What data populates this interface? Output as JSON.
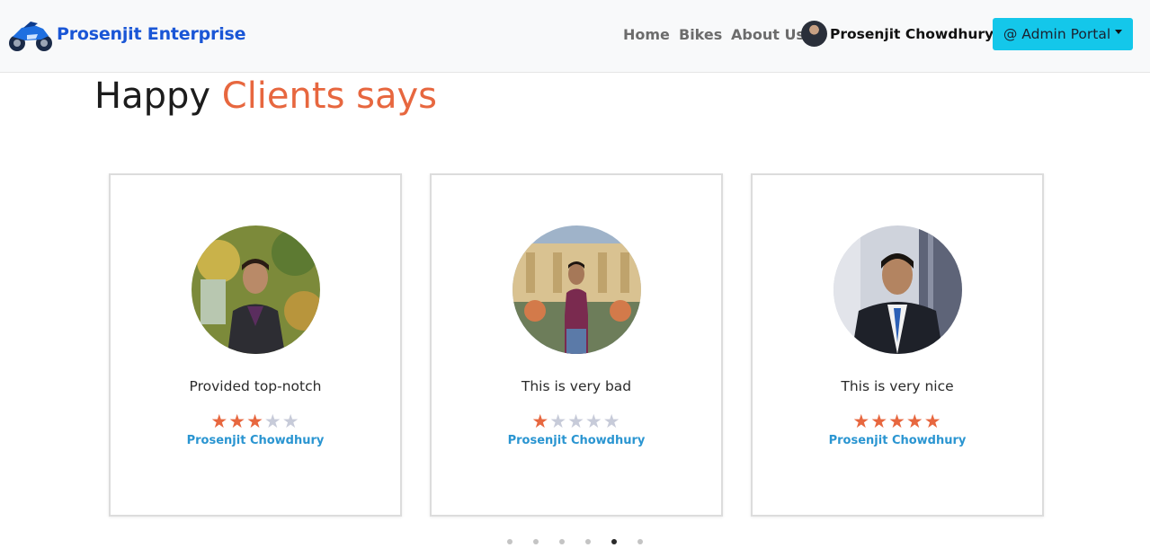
{
  "brand": {
    "name": "Prosenjit Enterprise",
    "icon": "motorbike-logo-icon"
  },
  "nav": {
    "links": [
      "Home",
      "Bikes",
      "About Us"
    ],
    "user_name": "Prosenjit Chowdhury",
    "admin_button": "@ Admin Portal"
  },
  "heading": {
    "part1": "Happy",
    "part2": "Clients says",
    "accent_color": "#e7673f"
  },
  "testimonials": [
    {
      "review": "Provided top-notch",
      "rating": 3,
      "max_rating": 5,
      "name": "Prosenjit Chowdhury"
    },
    {
      "review": "This is very bad",
      "rating": 1,
      "max_rating": 5,
      "name": "Prosenjit Chowdhury"
    },
    {
      "review": "This is very nice",
      "rating": 5,
      "max_rating": 5,
      "name": "Prosenjit Chowdhury"
    }
  ],
  "carousel": {
    "dot_count": 6,
    "active_index": 4
  },
  "colors": {
    "brand": "#1a56d6",
    "admin_button": "#14c7ea",
    "star_on": "#e7673f",
    "star_off": "#c7cbd9",
    "client_name": "#2a95d1"
  }
}
